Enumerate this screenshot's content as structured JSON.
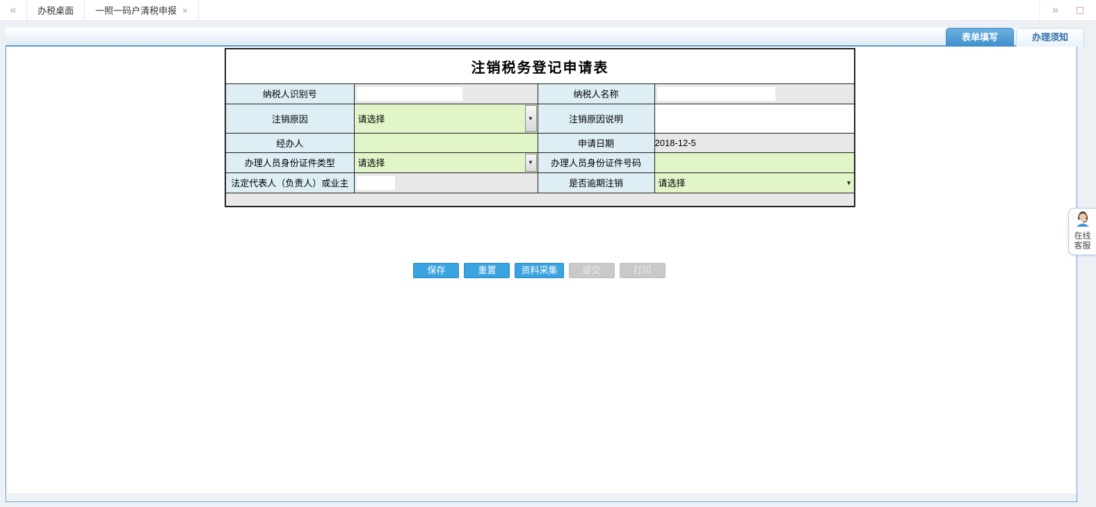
{
  "topbar": {
    "collapse_icon": "«",
    "expand_icon": "»",
    "tabs": [
      {
        "label": "办税桌面"
      },
      {
        "label": "一照一码户清税申报",
        "close_icon": "×"
      }
    ]
  },
  "side_tabs": {
    "form_fill": "表单填写",
    "notice": "办理须知"
  },
  "form": {
    "title": "注销税务登记申请表",
    "fields": {
      "taxpayer_id_label": "纳税人识别号",
      "taxpayer_id_value": "",
      "taxpayer_name_label": "纳税人名称",
      "taxpayer_name_value": "",
      "cancel_reason_label": "注销原因",
      "cancel_reason_value": "请选择",
      "cancel_reason_desc_label": "注销原因说明",
      "cancel_reason_desc_value": "",
      "handler_label": "经办人",
      "handler_value": "",
      "apply_date_label": "申请日期",
      "apply_date_value": "2018-12-5",
      "id_type_label": "办理人员身份证件类型",
      "id_type_value": "请选择",
      "id_number_label": "办理人员身份证件号码",
      "id_number_value": "",
      "legal_rep_label": "法定代表人（负责人）或业主",
      "legal_rep_value": "",
      "overdue_label": "是否逾期注销",
      "overdue_value": "请选择"
    },
    "dropdown_arrow": "▼"
  },
  "buttons": [
    {
      "label": "保存",
      "enabled": true
    },
    {
      "label": "重置",
      "enabled": true
    },
    {
      "label": "资料采集",
      "enabled": true
    },
    {
      "label": "提交",
      "enabled": false
    },
    {
      "label": "打印",
      "enabled": false
    }
  ],
  "service_widget": {
    "line1": "在线",
    "line2": "客服"
  },
  "colors": {
    "accent_blue": "#3ba3e0",
    "panel_border": "#5e9ccc",
    "label_cell_bg": "#ddeef5",
    "input_green": "#e1f5c9",
    "readonly_gray": "#e8e8e8"
  }
}
